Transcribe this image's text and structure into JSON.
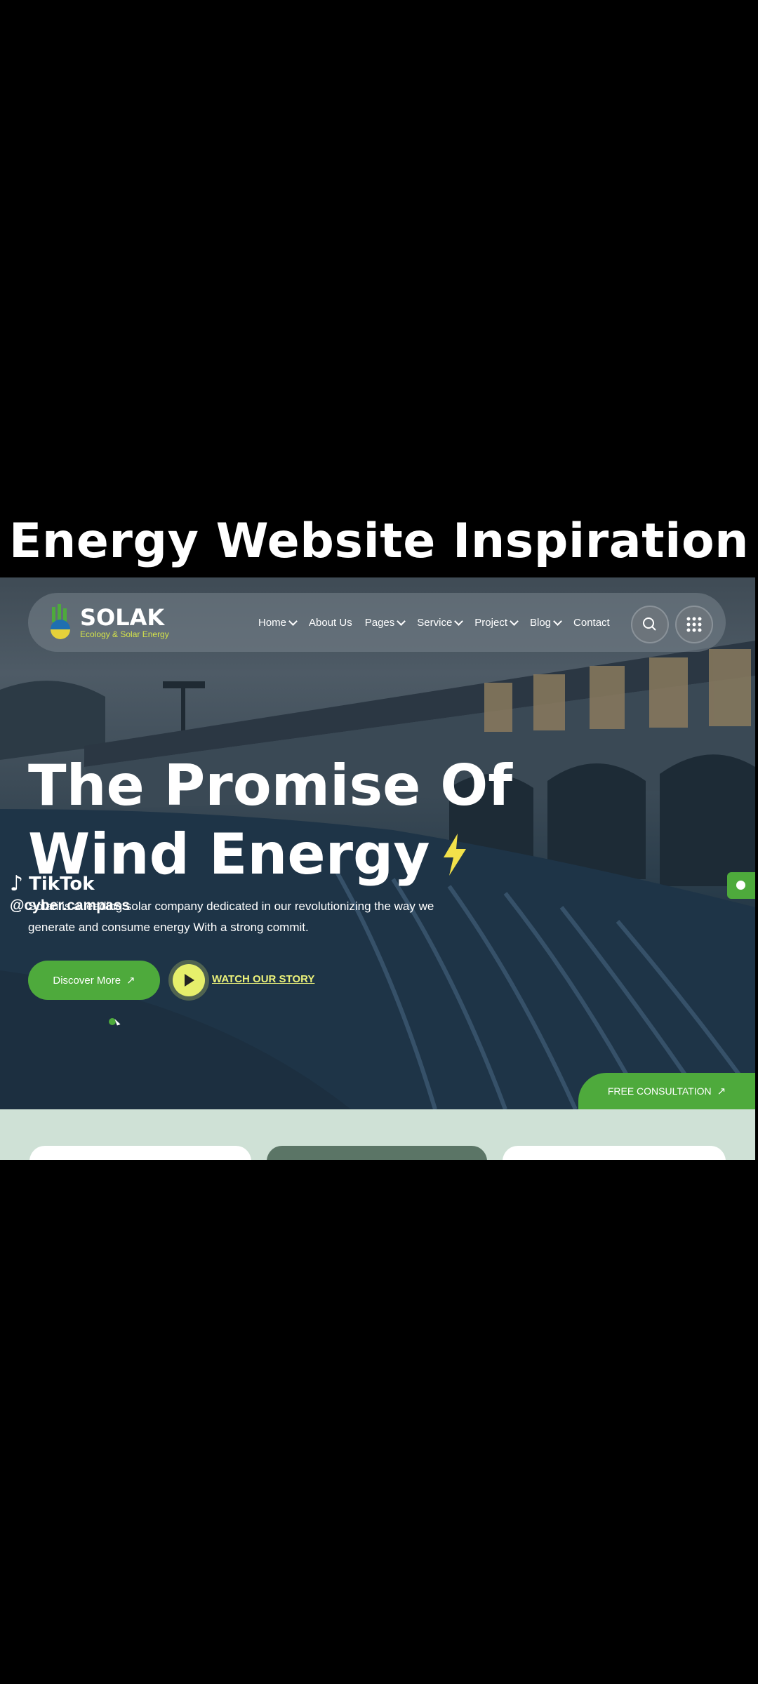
{
  "caption": "Energy Website Inspiration",
  "site": {
    "logo_name": "SOLAK",
    "logo_tagline": "Ecology & Solar Energy",
    "nav": [
      {
        "label": "Home",
        "dropdown": true
      },
      {
        "label": "About Us",
        "dropdown": false
      },
      {
        "label": "Pages",
        "dropdown": true
      },
      {
        "label": "Service",
        "dropdown": true
      },
      {
        "label": "Project",
        "dropdown": true
      },
      {
        "label": "Blog",
        "dropdown": true
      },
      {
        "label": "Contact",
        "dropdown": false
      }
    ],
    "icons": {
      "search": "search-icon",
      "grid": "grid-menu-icon"
    }
  },
  "hero": {
    "headline_line1": "The Promise Of",
    "headline_line2": "Wind Energy",
    "headline_icon": "lightning-bolt-icon",
    "description_line1": "Solari is a leading solar company dedicated in our revolutionizing the way we",
    "description_line2": "generate and consume energy With a strong commit.",
    "discover_label": "Discover More",
    "watch_label": "WATCH OUR STORY",
    "free_consultation_label": "FREE CONSULTATION"
  },
  "watermark": {
    "brand": "TikTok",
    "handle": "@cyber.campass"
  },
  "colors": {
    "accent_green": "#4eaa3c",
    "highlight_yellow": "#e6ef6b",
    "band": "#cfe1d6"
  }
}
